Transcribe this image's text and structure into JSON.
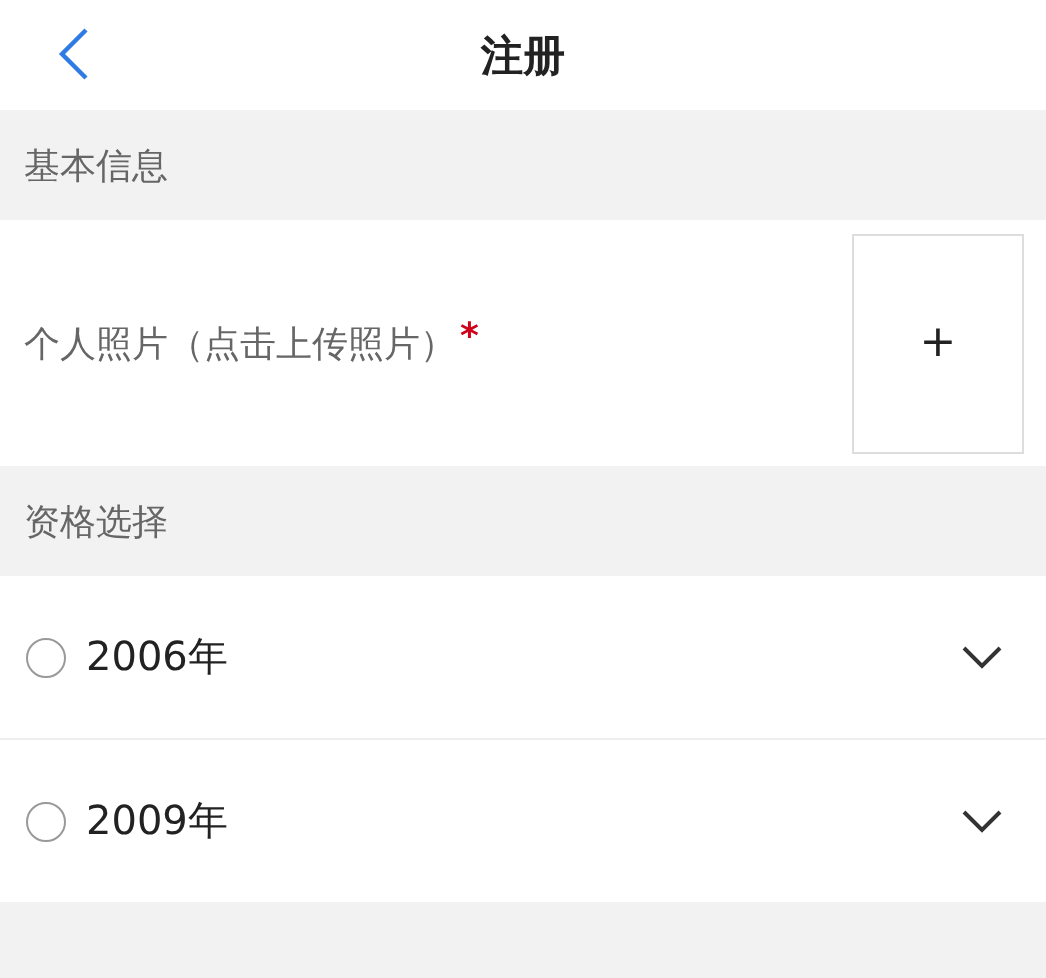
{
  "header": {
    "title": "注册"
  },
  "basic_info": {
    "title": "基本信息",
    "photo": {
      "label": "个人照片（点击上传照片）",
      "required_mark": "*",
      "button": "+"
    }
  },
  "qualification": {
    "title": "资格选择",
    "options": [
      {
        "label": "2006年",
        "selected": false,
        "expanded": false
      },
      {
        "label": "2009年",
        "selected": false,
        "expanded": false
      }
    ]
  }
}
